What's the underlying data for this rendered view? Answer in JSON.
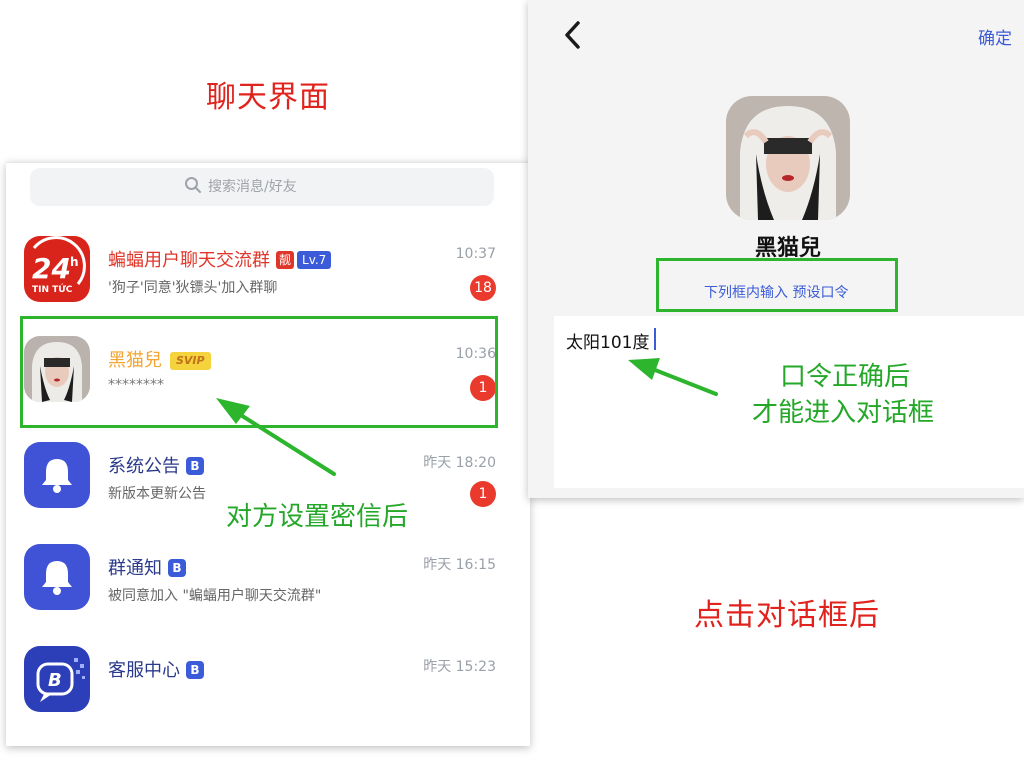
{
  "left": {
    "title": "聊天界面",
    "search_placeholder": "搜索消息/好友",
    "chats": [
      {
        "name": "蝙蝠用户聊天交流群",
        "tag_liang": "靓",
        "tag_level": "Lv.7",
        "preview": "'狗子'同意'狄镖头'加入群聊",
        "time": "10:37",
        "unread": "18",
        "avatar_text_1": "24",
        "avatar_text_2": "h",
        "avatar_text_3": "TIN TỨC"
      },
      {
        "name": "黑猫兒",
        "tag_vip": "SVIP",
        "preview": "********",
        "time": "10:36",
        "unread": "1"
      },
      {
        "name": "系统公告",
        "tag_b": "B",
        "preview": "新版本更新公告",
        "time": "昨天 18:20",
        "unread": "1"
      },
      {
        "name": "群通知",
        "tag_b": "B",
        "preview": "被同意加入 \"蝙蝠用户聊天交流群\"",
        "time": "昨天 16:15"
      },
      {
        "name": "客服中心",
        "tag_b": "B",
        "time": "昨天 15:23"
      }
    ],
    "annotation": "对方设置密信后"
  },
  "right": {
    "confirm": "确定",
    "profile_name": "黑猫兒",
    "hint": "下列框内输入 预设口令",
    "input_value": "太阳101度",
    "annotation_line1": "口令正确后",
    "annotation_line2": "才能进入对话框",
    "title": "点击对话框后"
  },
  "colors": {
    "brand_blue": "#4053d6",
    "annotation_green": "#2db52d",
    "annotation_red": "#e0231d",
    "unread_red": "#ea3a2d",
    "vip_gold": "#f4d33d"
  }
}
